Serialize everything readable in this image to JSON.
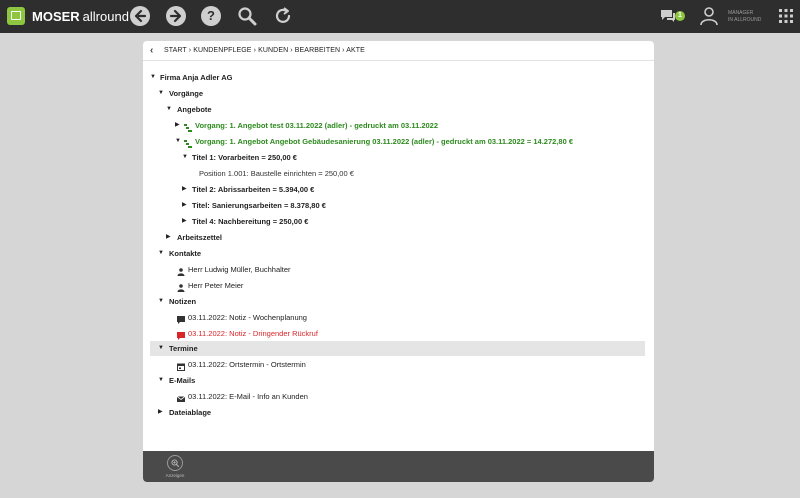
{
  "topbar": {
    "brand_bold": "MOSER",
    "brand_light": "allround",
    "icons": [
      "back-icon",
      "forward-icon",
      "help-icon",
      "search-icon",
      "refresh-icon",
      "chat-icon",
      "user-icon",
      "apps-grid-icon"
    ],
    "chat_count": "1",
    "user_line1": "MANAGER",
    "user_line2": "IN ALLROUND",
    "accent": "#8dc63f"
  },
  "breadcrumb": "START › KUNDENPFLEGE › KUNDEN › BEARBEITEN › AKTE",
  "tree": {
    "root": "Firma Anja Adler AG",
    "vorgaenge": "Vorgänge",
    "angebote": "Angebote",
    "vorgang1": "Vorgang: 1. Angebot test 03.11.2022 (adler) - gedruckt am 03.11.2022",
    "vorgang2": "Vorgang: 1. Angebot Angebot Gebäudesanierung 03.11.2022 (adler) - gedruckt am 03.11.2022 = 14.272,80 €",
    "titel1": "Titel 1: Vorarbeiten = 250,00 €",
    "position1": "Position 1.001: Baustelle einrichten = 250,00 €",
    "titel2": "Titel 2: Abrissarbeiten = 5.394,00 €",
    "titel3": "Titel: Sanierungsarbeiten = 8.378,80 €",
    "titel4": "Titel 4: Nachbereitung = 250,00 €",
    "arbeitszettel": "Arbeitszettel",
    "kontakte": "Kontakte",
    "kontakt1": "Herr Ludwig Müller, Buchhalter",
    "kontakt2": "Herr Peter Meier",
    "notizen": "Notizen",
    "notiz1": "03.11.2022: Notiz - Wochenplanung",
    "notiz2": "03.11.2022: Notiz - Dringender Rückruf",
    "termine": "Termine",
    "termin1": "03.11.2022: Ortstermin - Ortstermin",
    "emails": "E-Mails",
    "email1": "03.11.2022: E-Mail - Info an Kunden",
    "dateiablage": "Dateiablage"
  },
  "footer": {
    "zoom_label": "Anzeigen"
  },
  "colors": {
    "green": "#2e8a1f",
    "red": "#d9252a",
    "topbar": "#2e2e2e"
  }
}
